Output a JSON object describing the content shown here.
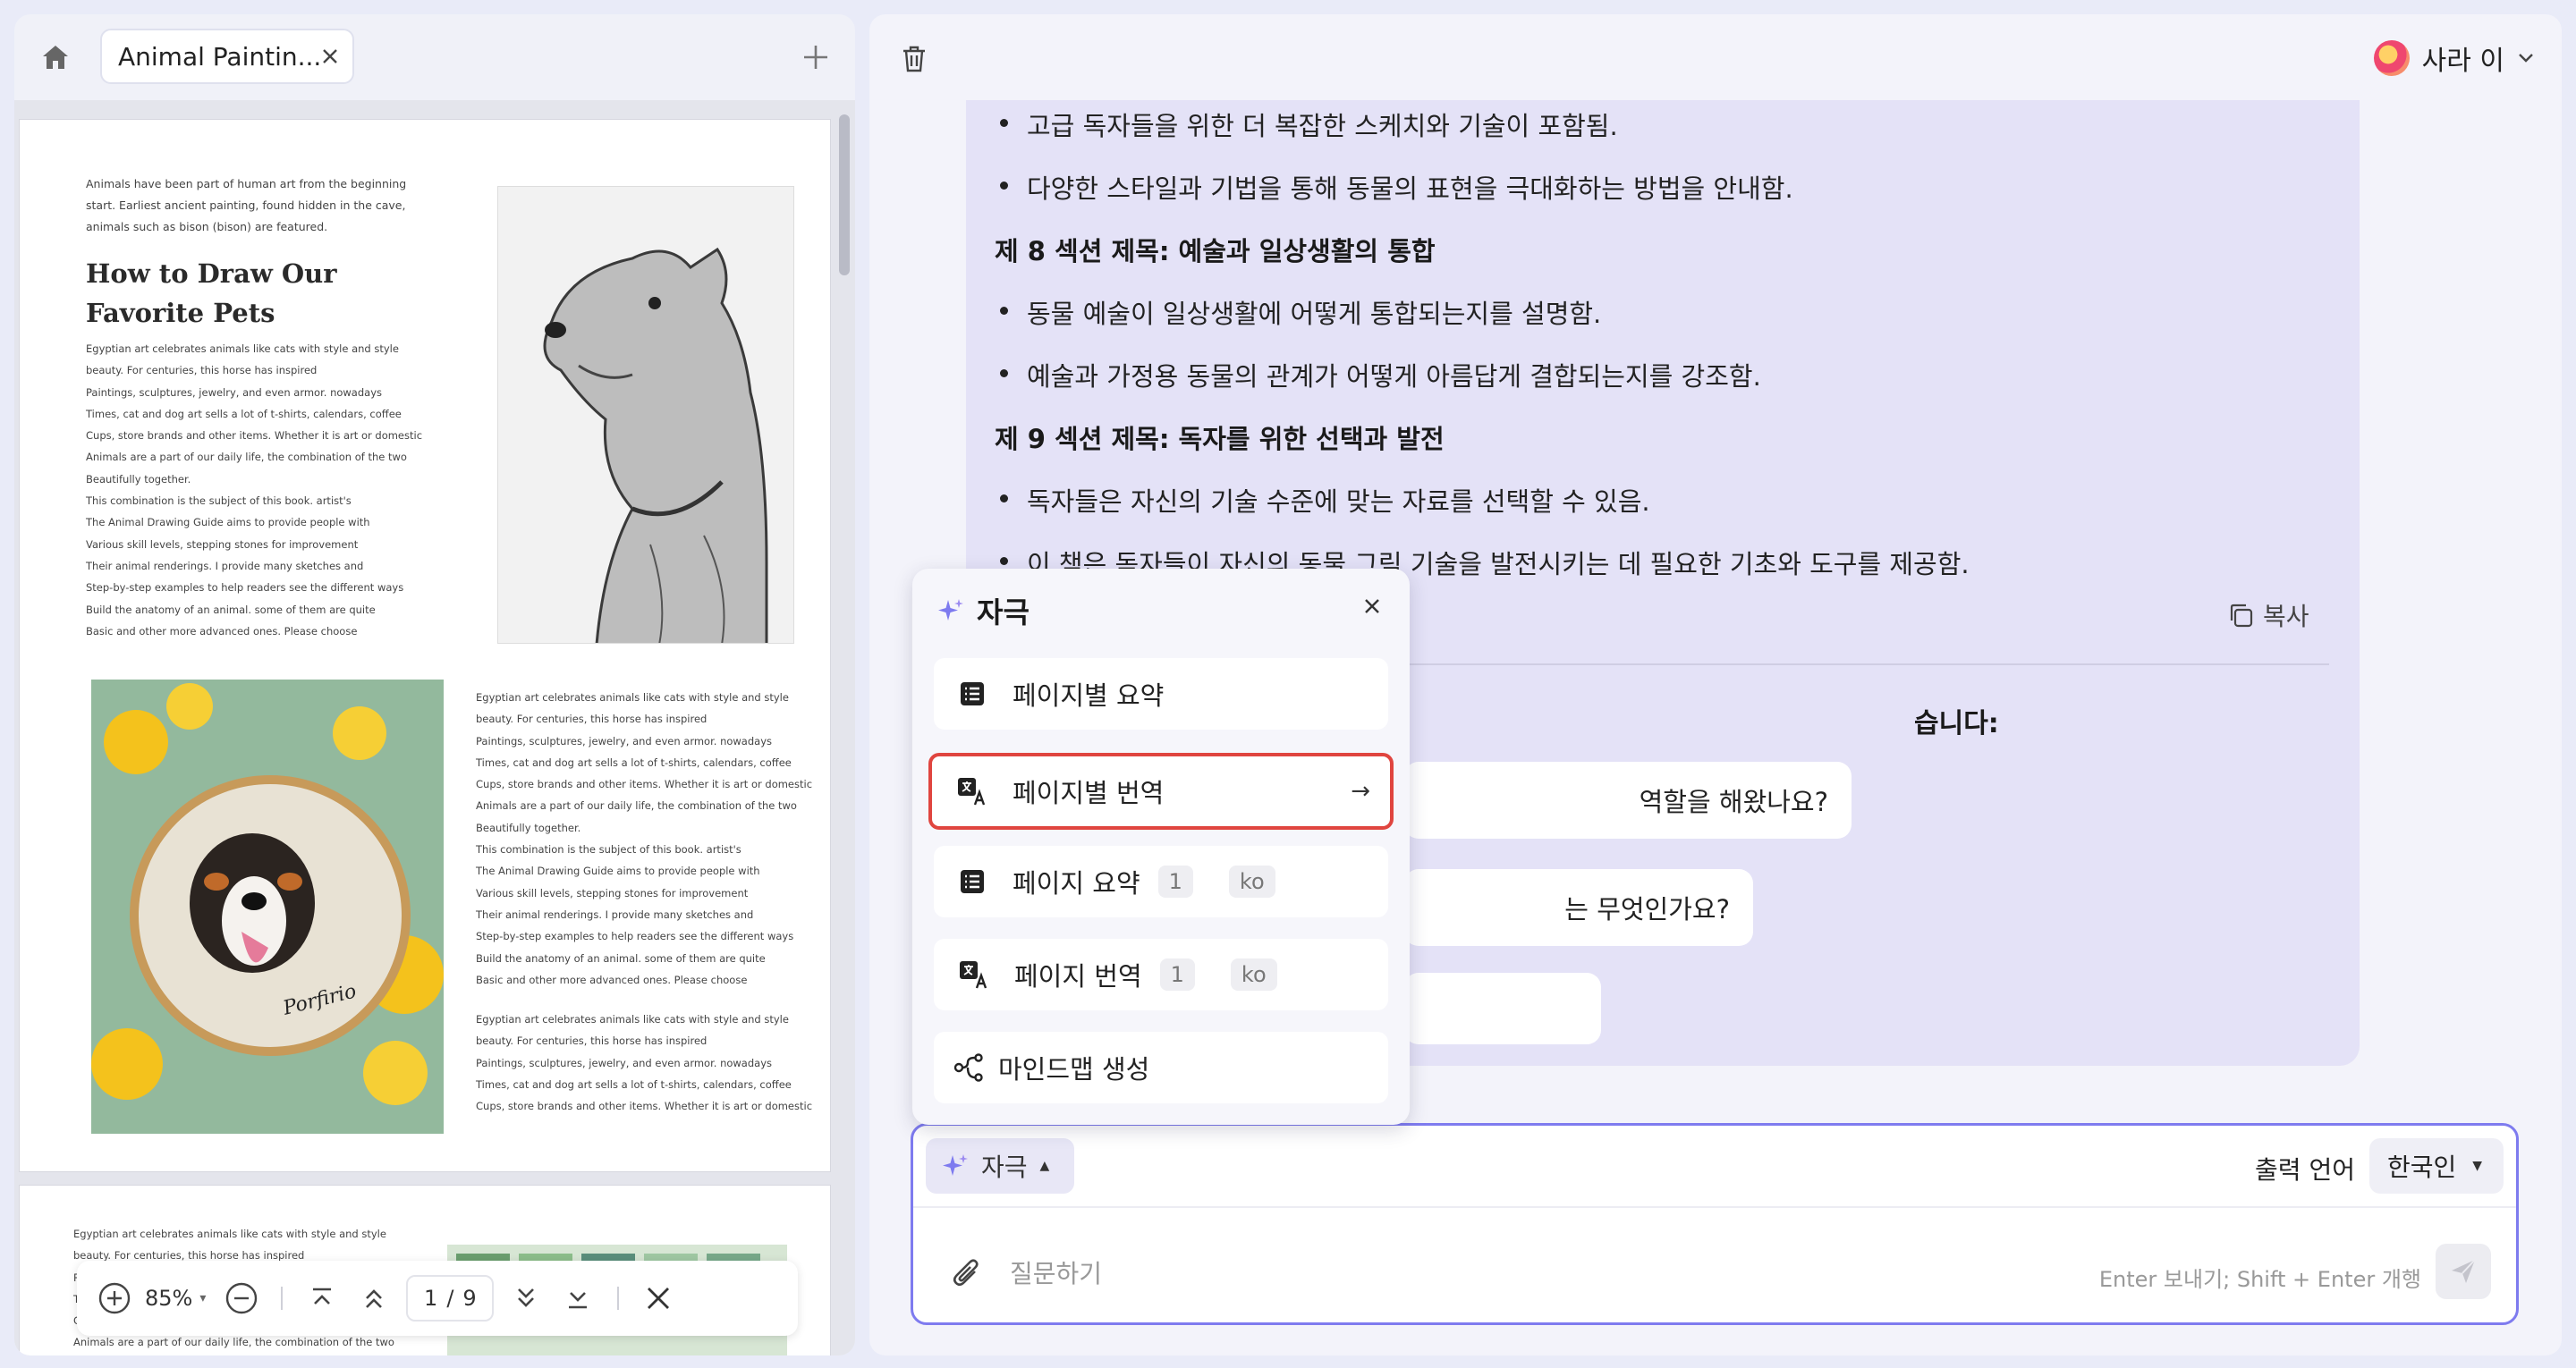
{
  "left": {
    "tab_title": "Animal Paintin...",
    "intro": "Animals have been part of human art from the beginning start. Earliest ancient painting, found hidden in the cave, animals such as bison (bison) are featured.",
    "book_title": "How to Draw Our Favorite Pets",
    "body_text_1": "Egyptian art celebrates animals like cats with style and style\nbeauty. For centuries, this horse has inspired\nPaintings, sculptures, jewelry, and even armor. nowadays\nTimes, cat and dog art sells a lot of t-shirts, calendars, coffee\nCups, store brands and other items. Whether it is art or domestic\nAnimals are a part of our daily life, the combination of the two\nBeautifully together.\nThis combination is the subject of this book. artist's\nThe Animal Drawing Guide aims to provide people with\nVarious skill levels, stepping stones for improvement\nTheir animal renderings. I provide many sketches and\nStep-by-step examples to help readers see the different ways\nBuild the anatomy of an animal. some of them are quite\nBasic and other more advanced ones. Please choose",
    "body_text_2": "Egyptian art celebrates animals like cats with style and style\nbeauty. For centuries, this horse has inspired\nPaintings, sculptures, jewelry, and even armor. nowadays\nTimes, cat and dog art sells a lot of t-shirts, calendars, coffee\nCups, store brands and other items. Whether it is art or domestic\nAnimals are a part of our daily life, the combination of the two\nBeautifully together.\nThis combination is the subject of this book. artist's\nThe Animal Drawing Guide aims to provide people with\nVarious skill levels, stepping stones for improvement\nTheir animal renderings. I provide many sketches and\nStep-by-step examples to help readers see the different ways\nBuild the anatomy of an animal. some of them are quite\nBasic and other more advanced ones. Please choose",
    "body_text_3": "Egyptian art celebrates animals like cats with style and style\nbeauty. For centuries, this horse has inspired\nPaintings, sculptures, jewelry, and even armor. nowadays\nTimes, cat and dog art sells a lot of t-shirts, calendars, coffee\nCups, store brands and other items. Whether it is art or domestic",
    "body_text_4": "Egyptian art celebrates animals like cats with style and style\nbeauty. For centuries, this horse has inspired\nPa\nTi\nCu\nAnimals are a part of our daily life, the combination of the two",
    "embroidery_signature": "Porfirio",
    "toolbar": {
      "zoom": "85%",
      "page_current": "1",
      "page_sep": "/",
      "page_total": "9"
    }
  },
  "right": {
    "user_name": "사라 이",
    "answer_lines": [
      {
        "type": "bullet",
        "text": "고급 독자들을 위한 더 복잡한 스케치와 기술이 포함됨."
      },
      {
        "type": "bullet",
        "text": "다양한 스타일과 기법을 통해 동물의 표현을 극대화하는 방법을 안내함."
      },
      {
        "type": "head",
        "text": "제 8 섹션 제목: 예술과 일상생활의 통합"
      },
      {
        "type": "bullet",
        "text": "동물 예술이 일상생활에 어떻게 통합되는지를 설명함."
      },
      {
        "type": "bullet",
        "text": "예술과 가정용 동물의 관계가 어떻게 아름답게 결합되는지를 강조함."
      },
      {
        "type": "head",
        "text": "제 9 섹션 제목: 독자를 위한 선택과 발전"
      },
      {
        "type": "bullet",
        "text": "독자들은 자신의 기술 수준에 맞는 자료를 선택할 수 있음."
      },
      {
        "type": "bullet",
        "text": "이 책은 독자들이 자신의 동물 그림 기술을 발전시키는 데 필요한 기초와 도구를 제공함."
      }
    ],
    "copy_label": "복사",
    "suggestions_title": "습니다:",
    "suggestions": [
      "역할을 해왔나요?",
      "는 무엇인가요?"
    ],
    "input": {
      "mode_label": "자극",
      "output_lang_label": "출력 언어",
      "lang_value": "한국인",
      "placeholder": "질문하기",
      "hint": "Enter 보내기; Shift + Enter 개행"
    }
  },
  "menu": {
    "title": "자극",
    "items": [
      {
        "label": "페이지별 요약"
      },
      {
        "label": "페이지별 번역"
      },
      {
        "label": "페이지 요약",
        "page": "1",
        "lang": "ko"
      },
      {
        "label": "페이지 번역",
        "page": "1",
        "lang": "ko"
      },
      {
        "label": "마인드맵 생성"
      }
    ]
  },
  "colors": {
    "accent": "#7e7bef",
    "highlight": "#e0453f",
    "answer_bg": "#e4e2f7"
  }
}
